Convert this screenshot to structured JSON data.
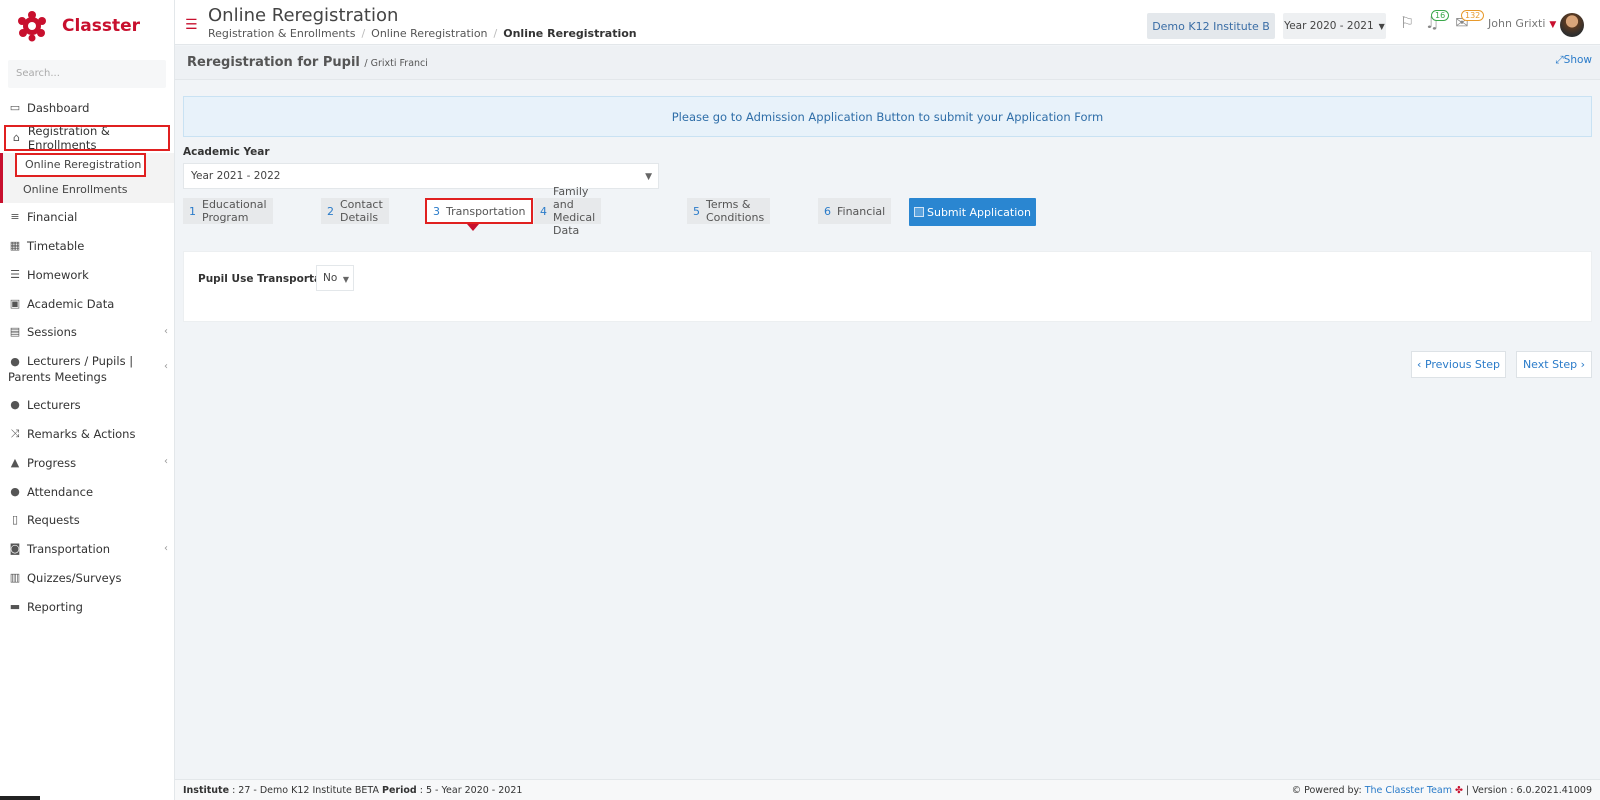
{
  "app": {
    "name": "Classter",
    "search_placeholder": "Search..."
  },
  "sidebar": {
    "items": [
      {
        "label": "Dashboard",
        "icon": "laptop-icon"
      },
      {
        "label": "Registration & Enrollments",
        "icon": "bank-icon"
      },
      {
        "label": "Financial",
        "icon": "coins-icon"
      },
      {
        "label": "Timetable",
        "icon": "calendar-icon"
      },
      {
        "label": "Homework",
        "icon": "list-icon"
      },
      {
        "label": "Academic Data",
        "icon": "teacher-board-icon"
      },
      {
        "label": "Sessions",
        "icon": "presentation-icon"
      },
      {
        "label": "Lecturers / Pupils | Parents Meetings",
        "icon": "users-gear-icon"
      },
      {
        "label": "Lecturers",
        "icon": "users-icon"
      },
      {
        "label": "Remarks & Actions",
        "icon": "shuffle-icon"
      },
      {
        "label": "Progress",
        "icon": "graduation-cap-icon"
      },
      {
        "label": "Attendance",
        "icon": "user-check-icon"
      },
      {
        "label": "Requests",
        "icon": "file-icon"
      },
      {
        "label": "Transportation",
        "icon": "bus-icon"
      },
      {
        "label": "Quizzes/Surveys",
        "icon": "book-icon"
      },
      {
        "label": "Reporting",
        "icon": "printer-icon"
      }
    ],
    "sub_items": [
      {
        "label": "Online Reregistration"
      },
      {
        "label": "Online Enrollments"
      }
    ]
  },
  "header": {
    "title": "Online Reregistration",
    "breadcrumb": [
      "Registration & Enrollments",
      "Online Reregistration",
      "Online Reregistration"
    ],
    "institute": "Demo K12 Institute B",
    "year": "Year 2020 - 2021",
    "notifications_count": "16",
    "messages_count": "132",
    "user_name": "John Grixti"
  },
  "subheader": {
    "title": "Reregistration for Pupil",
    "subtitle": "/ Grixti Franci",
    "show_label": "Show"
  },
  "main": {
    "info_message": "Please go to Admission Application Button to submit your Application Form",
    "academic_year_label": "Academic Year",
    "academic_year_value": "Year 2021 - 2022",
    "steps": [
      {
        "num": "1",
        "label": "Educational Program"
      },
      {
        "num": "2",
        "label": "Contact Details"
      },
      {
        "num": "3",
        "label": "Transportation"
      },
      {
        "num": "4",
        "label": "Family and Medical Data"
      },
      {
        "num": "5",
        "label": "Terms & Conditions"
      },
      {
        "num": "6",
        "label": "Financial"
      }
    ],
    "active_step": 3,
    "submit_label": "Submit Application",
    "transport_label": "Pupil Use Transportation",
    "transport_value": "No",
    "prev_label": "Previous Step",
    "next_label": "Next Step"
  },
  "footer": {
    "institute_label": "Institute",
    "institute_value": ": 27 - Demo K12 Institute BETA",
    "period_label": "Period",
    "period_value": ": 5 - Year 2020 - 2021",
    "powered_by": "Powered by:",
    "team": "The Classter Team",
    "version": "| Version : 6.0.2021.41009"
  },
  "colors": {
    "brand": "#c8102e",
    "accent": "#2a86d1",
    "highlight": "#e02020"
  }
}
